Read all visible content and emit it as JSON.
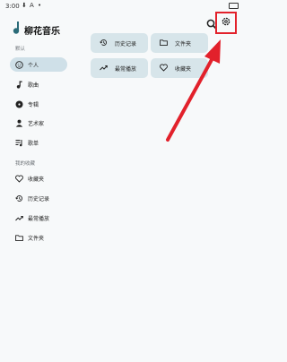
{
  "status_bar": {
    "time": "3:00",
    "icons": [
      "download-icon",
      "text-icon",
      "dot-icon",
      "battery-icon"
    ]
  },
  "header": {
    "app_title": "柳花音乐",
    "search_icon": "search-icon",
    "settings_icon": "gear-icon"
  },
  "library": {
    "section_label": "默认",
    "items": [
      {
        "label": "个人",
        "icon": "face-icon",
        "active": true
      },
      {
        "label": "歌曲",
        "icon": "music-note-icon"
      },
      {
        "label": "专辑",
        "icon": "album-icon"
      },
      {
        "label": "艺术家",
        "icon": "person-icon"
      },
      {
        "label": "歌单",
        "icon": "playlist-icon"
      }
    ]
  },
  "my_library": {
    "section_label": "我的收藏",
    "items": [
      {
        "label": "收藏夹",
        "icon": "heart-icon"
      },
      {
        "label": "历史记录",
        "icon": "history-icon"
      },
      {
        "label": "最常播放",
        "icon": "trending-icon"
      },
      {
        "label": "文件夹",
        "icon": "folder-icon"
      }
    ]
  },
  "cards": [
    {
      "label": "历史记录",
      "icon": "history-icon"
    },
    {
      "label": "文件夹",
      "icon": "folder-icon"
    },
    {
      "label": "最常播放",
      "icon": "trending-icon"
    },
    {
      "label": "收藏夹",
      "icon": "heart-icon"
    }
  ],
  "colors": {
    "accent": "#cfe0e8",
    "card": "#d7e5ea",
    "highlight": "#e2212b",
    "logo": "#2a6b78"
  }
}
